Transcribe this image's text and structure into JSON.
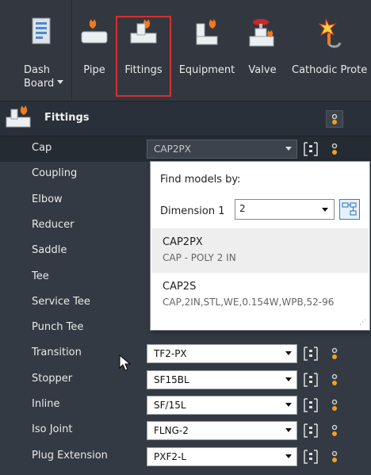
{
  "ribbon": {
    "buttons": [
      {
        "label": "Dash\nBoard",
        "icon": "dashboard-icon"
      },
      {
        "label": "Pipe",
        "icon": "pipe-icon"
      },
      {
        "label": "Fittings",
        "icon": "fittings-icon"
      },
      {
        "label": "Equipment",
        "icon": "equipment-icon"
      },
      {
        "label": "Valve",
        "icon": "valve-icon"
      },
      {
        "label": "Cathodic Prote",
        "icon": "cathodic-protection-icon"
      }
    ],
    "dash_line1": "Dash",
    "dash_line2": "Board",
    "highlight_color": "#d62f2f"
  },
  "panel": {
    "title": "Fittings"
  },
  "rows": [
    {
      "name": "Cap",
      "value": "CAP2PX"
    },
    {
      "name": "Coupling",
      "value": ""
    },
    {
      "name": "Elbow",
      "value": ""
    },
    {
      "name": "Reducer",
      "value": ""
    },
    {
      "name": "Saddle",
      "value": ""
    },
    {
      "name": "Tee",
      "value": ""
    },
    {
      "name": "Service Tee",
      "value": ""
    },
    {
      "name": "Punch Tee",
      "value": ""
    },
    {
      "name": "Transition",
      "value": "TF2-PX"
    },
    {
      "name": "Stopper",
      "value": "SF15BL"
    },
    {
      "name": "Inline",
      "value": "SF/15L"
    },
    {
      "name": "Iso Joint",
      "value": "FLNG-2"
    },
    {
      "name": "Plug Extension",
      "value": "PXF2-L"
    }
  ],
  "popup": {
    "title": "Find models by:",
    "dimension_label": "Dimension 1",
    "dimension_value": "2",
    "results": [
      {
        "model": "CAP2PX",
        "desc": "CAP - POLY 2 IN"
      },
      {
        "model": "CAP2S",
        "desc": "CAP,2IN,STL,WE,0.154W,WPB,52-96"
      }
    ]
  }
}
